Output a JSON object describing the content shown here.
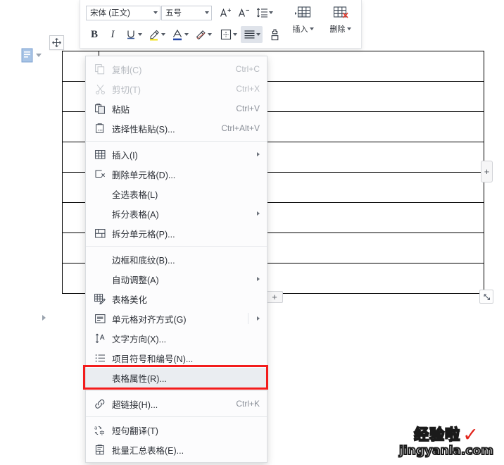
{
  "toolbar": {
    "font_name": "宋体 (正文)",
    "font_size": "五号",
    "buttons": {
      "grow_font": "A+",
      "shrink_font": "A-",
      "line_spacing": "line-spacing",
      "bold": "B",
      "italic": "I",
      "underline": "U",
      "highlight": "highlight",
      "font_color": "A",
      "shading": "shading",
      "borders": "borders",
      "align": "align",
      "format_painter": "format-painter"
    },
    "insert_label": "插入",
    "delete_label": "删除"
  },
  "context_menu": {
    "items": [
      {
        "label": "复制(C)",
        "shortcut": "Ctrl+C",
        "icon": "copy-icon",
        "disabled": true,
        "submenu": false,
        "sep_after": false
      },
      {
        "label": "剪切(T)",
        "shortcut": "Ctrl+X",
        "icon": "cut-icon",
        "disabled": true,
        "submenu": false,
        "sep_after": false
      },
      {
        "label": "粘贴",
        "shortcut": "Ctrl+V",
        "icon": "paste-icon",
        "disabled": false,
        "submenu": false,
        "sep_after": false
      },
      {
        "label": "选择性粘贴(S)...",
        "shortcut": "Ctrl+Alt+V",
        "icon": "paste-special-icon",
        "disabled": false,
        "submenu": false,
        "sep_after": true
      },
      {
        "label": "插入(I)",
        "shortcut": "",
        "icon": "insert-table-icon",
        "disabled": false,
        "submenu": true,
        "sep_after": false
      },
      {
        "label": "删除单元格(D)...",
        "shortcut": "",
        "icon": "delete-cell-icon",
        "disabled": false,
        "submenu": false,
        "sep_after": false
      },
      {
        "label": "全选表格(L)",
        "shortcut": "",
        "icon": "",
        "disabled": false,
        "submenu": false,
        "sep_after": false
      },
      {
        "label": "拆分表格(A)",
        "shortcut": "",
        "icon": "",
        "disabled": false,
        "submenu": true,
        "sep_after": false
      },
      {
        "label": "拆分单元格(P)...",
        "shortcut": "",
        "icon": "split-cell-icon",
        "disabled": false,
        "submenu": false,
        "sep_after": true
      },
      {
        "label": "边框和底纹(B)...",
        "shortcut": "",
        "icon": "",
        "disabled": false,
        "submenu": false,
        "sep_after": false
      },
      {
        "label": "自动调整(A)",
        "shortcut": "",
        "icon": "",
        "disabled": false,
        "submenu": true,
        "sep_after": false
      },
      {
        "label": "表格美化",
        "shortcut": "",
        "icon": "table-beautify-icon",
        "disabled": false,
        "submenu": false,
        "sep_after": false
      },
      {
        "label": "单元格对齐方式(G)",
        "shortcut": "",
        "icon": "cell-align-icon",
        "disabled": false,
        "submenu": true,
        "sep_after": false
      },
      {
        "label": "文字方向(X)...",
        "shortcut": "",
        "icon": "text-direction-icon",
        "disabled": false,
        "submenu": false,
        "sep_after": false
      },
      {
        "label": "项目符号和编号(N)...",
        "shortcut": "",
        "icon": "bullets-numbering-icon",
        "disabled": false,
        "submenu": false,
        "sep_after": false
      },
      {
        "label": "表格属性(R)...",
        "shortcut": "",
        "icon": "",
        "disabled": false,
        "submenu": false,
        "sep_after": true,
        "highlighted": true
      },
      {
        "label": "超链接(H)...",
        "shortcut": "Ctrl+K",
        "icon": "hyperlink-icon",
        "disabled": false,
        "submenu": false,
        "sep_after": true
      },
      {
        "label": "短句翻译(T)",
        "shortcut": "",
        "icon": "translate-icon",
        "disabled": false,
        "submenu": false,
        "sep_after": false
      },
      {
        "label": "批量汇总表格(E)...",
        "shortcut": "",
        "icon": "batch-summary-icon",
        "disabled": false,
        "submenu": false,
        "sep_after": false,
        "crown": "♛"
      }
    ]
  },
  "document": {
    "table_rows": 8,
    "table_cols": 2,
    "add_row_label": "+",
    "add_col_label": "+"
  },
  "watermark": {
    "cn": "经验啦",
    "check": "✓",
    "domain": "jingyanla.com"
  },
  "colors": {
    "accent_red": "#f31c1c",
    "crown_gold": "#f2a43a",
    "menu_bg": "#fcfcfd",
    "highlight_bg": "#eaedf1"
  }
}
